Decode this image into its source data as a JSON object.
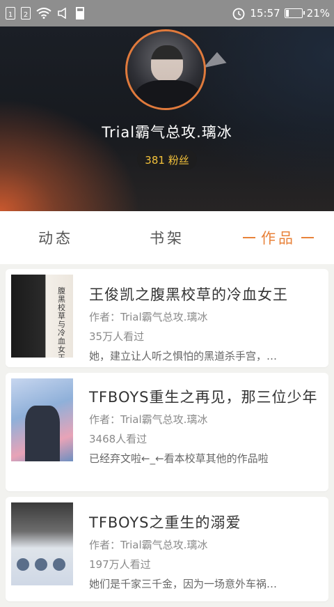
{
  "status_bar": {
    "sim1": "1",
    "sim2": "2",
    "time": "15:57",
    "battery": "21%",
    "battery_level": 0.21
  },
  "profile": {
    "username": "Trial霸气总攻.璃冰",
    "fans": "381 粉丝"
  },
  "tabs": [
    {
      "label": "动态"
    },
    {
      "label": "书架"
    },
    {
      "label": "作品",
      "active": true
    }
  ],
  "works": [
    {
      "title": "王俊凯之腹黑校草的冷血女王",
      "author": "作者：Trial霸气总攻.璃冰",
      "views": "35万人看过",
      "desc": "她，建立让人听之惧怕的黑道杀手宫，…",
      "cover_text": "腹黑校草与冷血女王"
    },
    {
      "title": "TFBOYS重生之再见，那三位少年",
      "author": "作者：Trial霸气总攻.璃冰",
      "views": "3468人看过",
      "desc": "已经弃文啦←_←看本校草其他的作品啦"
    },
    {
      "title": "TFBOYS之重生的溺爱",
      "author": "作者：Trial霸气总攻.璃冰",
      "views": "197万人看过",
      "desc": "她们是千家三千金，因为一场意外车祸…"
    }
  ]
}
